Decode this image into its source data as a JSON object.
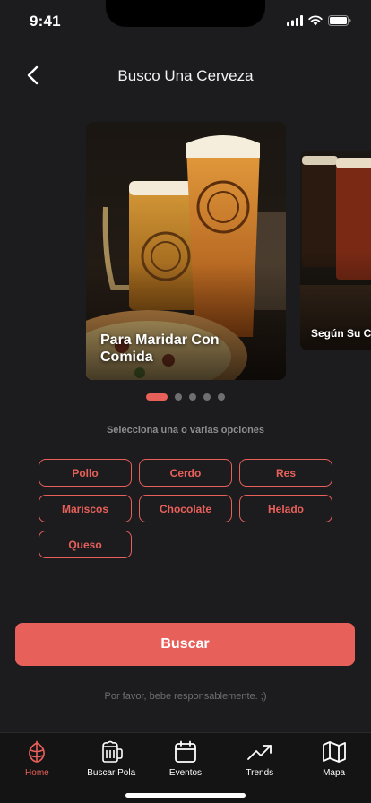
{
  "status": {
    "time": "9:41"
  },
  "header": {
    "title": "Busco Una Cerveza"
  },
  "carousel": {
    "cards": [
      {
        "caption": "Para Maridar Con Comida"
      },
      {
        "caption": "Según Su C"
      }
    ],
    "dot_count": 5,
    "active_index": 0
  },
  "prompt": "Selecciona una o varias opciones",
  "options": [
    "Pollo",
    "Cerdo",
    "Res",
    "Mariscos",
    "Chocolate",
    "Helado",
    "Queso"
  ],
  "search_label": "Buscar",
  "disclaimer": "Por favor, bebe responsablemente. ;)",
  "tabs": [
    {
      "label": "Home",
      "icon": "hop-icon",
      "active": true
    },
    {
      "label": "Buscar Pola",
      "icon": "beer-mug-icon",
      "active": false
    },
    {
      "label": "Eventos",
      "icon": "calendar-icon",
      "active": false
    },
    {
      "label": "Trends",
      "icon": "trending-up-icon",
      "active": false
    },
    {
      "label": "Mapa",
      "icon": "map-icon",
      "active": false
    }
  ],
  "colors": {
    "accent": "#e8605a",
    "background": "#1c1c1e",
    "tab_bar": "#141414"
  }
}
